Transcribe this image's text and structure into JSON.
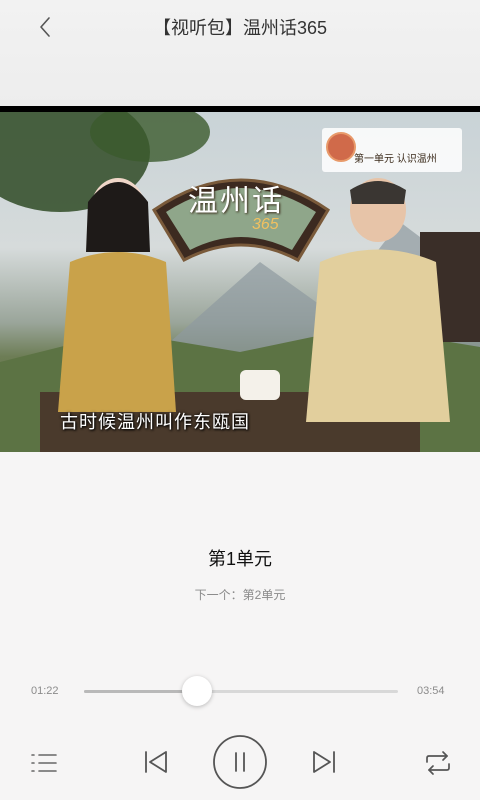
{
  "header": {
    "title": "【视听包】温州话365"
  },
  "video": {
    "logo_text": "第一单元  认识温州",
    "fan_title": "温州话",
    "fan_subtitle": "365",
    "caption": "古时候温州叫作东瓯国"
  },
  "player": {
    "track_title": "第1单元",
    "next_label": "下一个：第2单元",
    "current_time": "01:22",
    "duration": "03:54",
    "progress": 0.36
  },
  "icons": {
    "back": "chevron-left-icon",
    "playlist": "list-icon",
    "previous": "skip-previous-icon",
    "pause": "pause-icon",
    "next": "skip-next-icon",
    "repeat": "repeat-icon"
  }
}
